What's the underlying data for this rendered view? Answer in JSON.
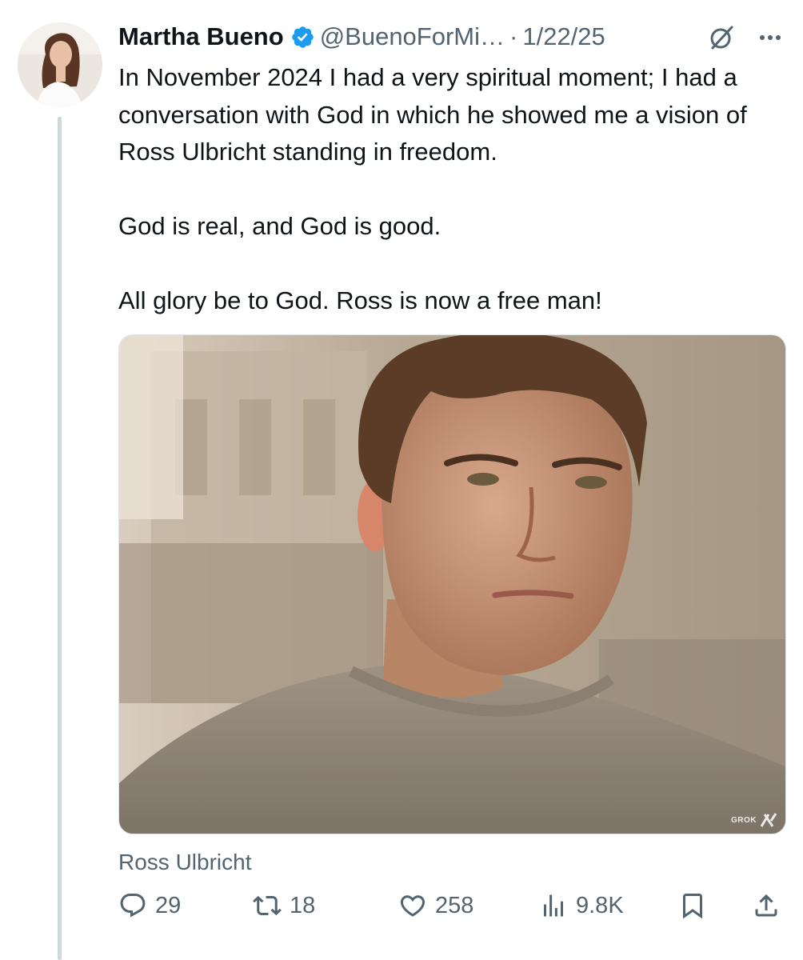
{
  "tweet": {
    "author": {
      "display_name": "Martha Bueno",
      "verified_icon": "verified-badge-icon",
      "handle": "@BuenoForMi…",
      "separator": "·",
      "date": "1/22/25"
    },
    "text": {
      "paragraph1": "In November 2024 I had a very spiritual moment; I had a conversation with God in which he showed me a vision of Ross Ulbricht standing in freedom.",
      "paragraph2": "God is real, and God is good.",
      "paragraph3": "All glory be to God. Ross is now a free man!"
    },
    "media": {
      "watermark": "GROK",
      "caption": "Ross Ulbricht"
    },
    "actions": {
      "replies": "29",
      "reposts": "18",
      "likes": "258",
      "views": "9.8K"
    }
  },
  "colors": {
    "text_primary": "#0f1419",
    "text_secondary": "#536471",
    "verified_blue": "#1d9bf0",
    "thread_line": "#cfd9de"
  },
  "icons": [
    "grok-icon",
    "more-icon",
    "reply-icon",
    "repost-icon",
    "like-icon",
    "views-icon",
    "bookmark-icon",
    "share-icon"
  ]
}
